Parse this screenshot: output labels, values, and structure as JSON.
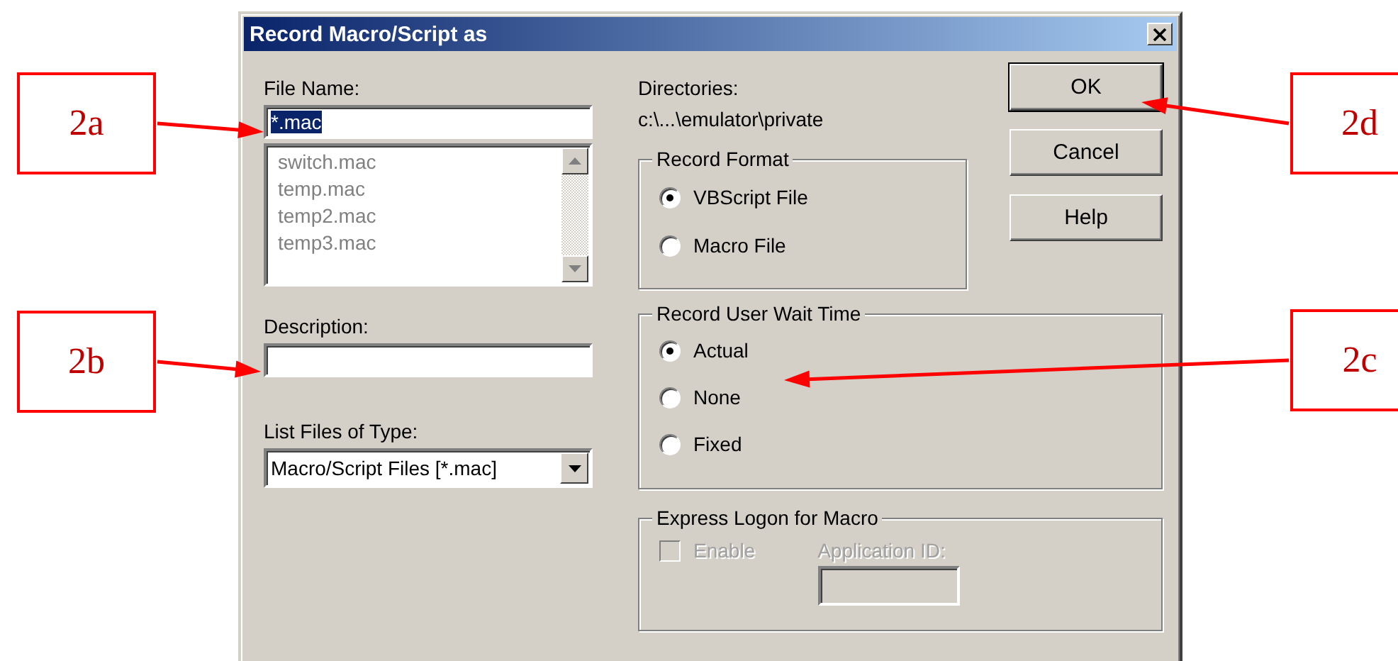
{
  "window": {
    "title": "Record Macro/Script as"
  },
  "file_name": {
    "label": "File Name:",
    "value": "*.mac",
    "value_highlighted": true
  },
  "file_list": {
    "disabled": true,
    "items": [
      "switch.mac",
      "temp.mac",
      "temp2.mac",
      "temp3.mac"
    ]
  },
  "description": {
    "label": "Description:"
  },
  "file_type": {
    "label": "List Files of Type:",
    "value": "Macro/Script Files [*.mac]"
  },
  "directories": {
    "label": "Directories:",
    "path": "c:\\...\\emulator\\private"
  },
  "record_format": {
    "title": "Record Format",
    "options": [
      {
        "label": "VBScript File",
        "selected": true
      },
      {
        "label": "Macro File",
        "selected": false
      }
    ]
  },
  "wait_time": {
    "title": "Record User Wait Time",
    "options": [
      {
        "label": "Actual",
        "selected": true
      },
      {
        "label": "None",
        "selected": false
      },
      {
        "label": "Fixed",
        "selected": false
      }
    ]
  },
  "express_logon": {
    "title": "Express Logon for Macro",
    "enable": {
      "label": "Enable",
      "checked": false,
      "disabled": true
    },
    "app_id": {
      "label": "Application ID:",
      "disabled": true
    }
  },
  "buttons": [
    {
      "label": "OK",
      "default": true
    },
    {
      "label": "Cancel",
      "default": false
    },
    {
      "label": "Help",
      "default": false
    }
  ],
  "callouts": [
    {
      "label": "2a"
    },
    {
      "label": "2d"
    },
    {
      "label": "2b"
    },
    {
      "label": "2c"
    }
  ]
}
